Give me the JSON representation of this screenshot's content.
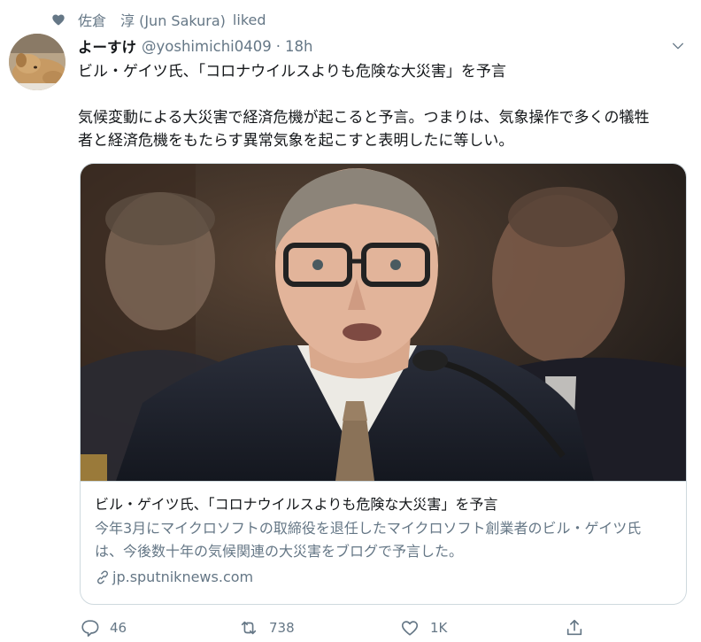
{
  "social_context": {
    "icon": "heart-icon",
    "name": "佐倉　淳 (Jun Sakura)",
    "action": "liked"
  },
  "tweet": {
    "avatar_icon": "dog-avatar",
    "display_name": "よーすけ",
    "handle": "@yoshimichi0409",
    "separator": "·",
    "time": "18h",
    "text_lines": [
      "ビル・ゲイツ氏、「コロナウイルスよりも危険な大災害」を予言",
      "気候変動による大災害で経済危機が起こると予言。つまりは、気象操作で多くの犠牲",
      "者と経済危機をもたらす異常気象を起こすと表明したに等しい。"
    ]
  },
  "card": {
    "image_description": "photo of Bill Gates speaking at a hearing",
    "title": "ビル・ゲイツ氏、「コロナウイルスよりも危険な大災害」を予言",
    "description_lines": [
      "今年3月にマイクロソフトの取締役を退任したマイクロソフト創業者のビル・ゲイツ氏",
      "は、今後数十年の気候関連の大災害をブログで予言した。"
    ],
    "domain": "jp.sputniknews.com"
  },
  "actions": {
    "reply_count": "46",
    "retweet_count": "738",
    "like_count": "1K",
    "share_label": ""
  },
  "colors": {
    "secondary_text": "#657786",
    "primary_text": "#14171a",
    "border": "#cfd9de"
  }
}
